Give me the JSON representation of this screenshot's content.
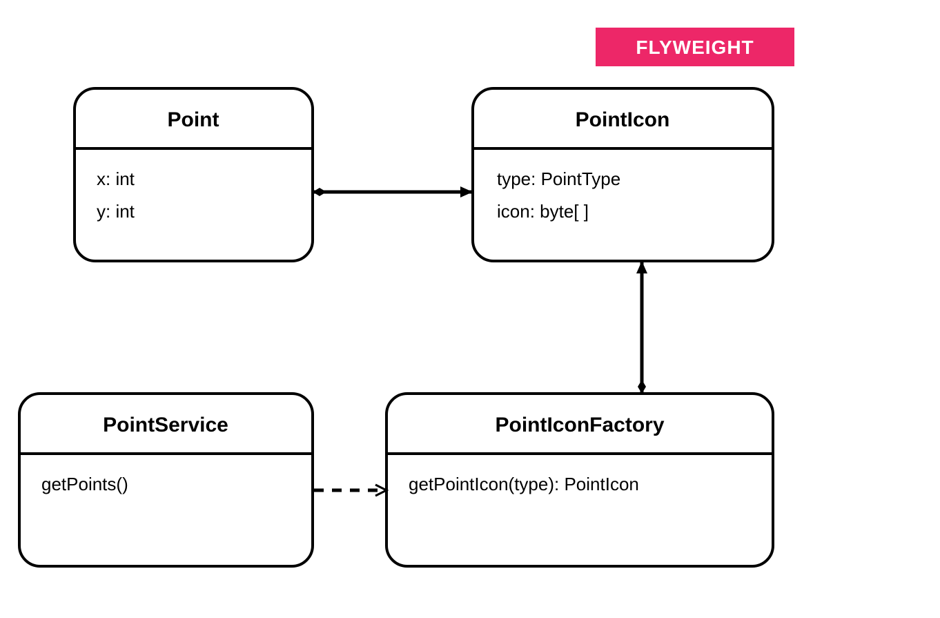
{
  "badge": {
    "label": "FLYWEIGHT",
    "bg": "#ed2768",
    "fg": "#ffffff"
  },
  "classes": {
    "point": {
      "name": "Point",
      "attributes": [
        "x: int",
        "y: int"
      ]
    },
    "pointIcon": {
      "name": "PointIcon",
      "attributes": [
        "type: PointType",
        "icon: byte[ ]"
      ]
    },
    "pointService": {
      "name": "PointService",
      "operations": [
        "getPoints()"
      ]
    },
    "pointIconFactory": {
      "name": "PointIconFactory",
      "operations": [
        "getPointIcon(type): PointIcon"
      ]
    }
  },
  "relations": [
    {
      "from": "Point",
      "to": "PointIcon",
      "type": "composition-arrow"
    },
    {
      "from": "PointIconFactory",
      "to": "PointIcon",
      "type": "composition-arrow"
    },
    {
      "from": "PointService",
      "to": "PointIconFactory",
      "type": "dependency-dashed"
    }
  ]
}
